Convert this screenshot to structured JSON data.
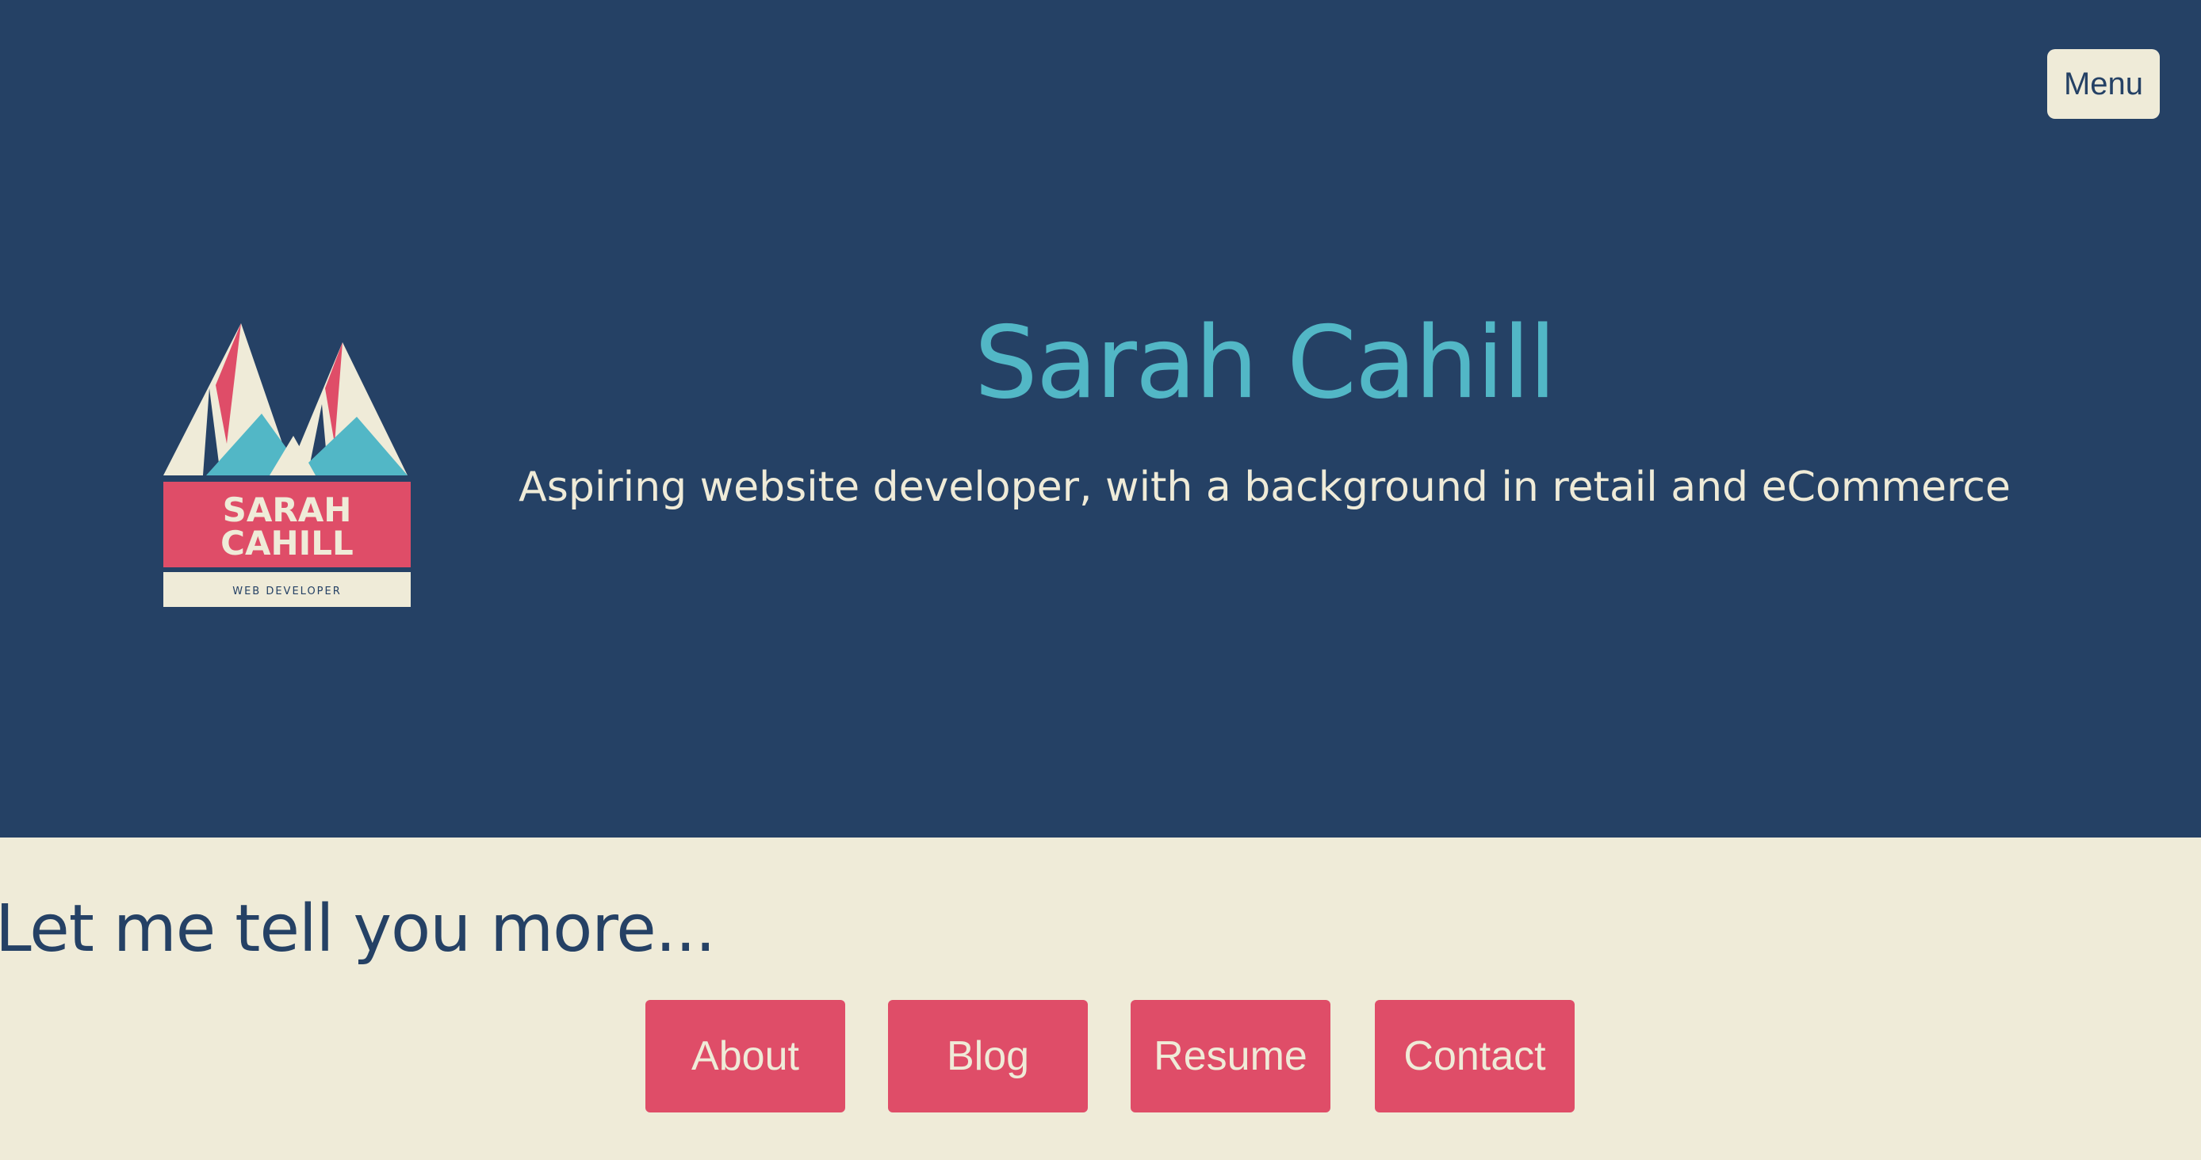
{
  "header": {
    "menu_label": "Menu"
  },
  "hero": {
    "logo": {
      "name_line1": "SARAH",
      "name_line2": "CAHILL",
      "subtitle": "WEB DEVELOPER"
    },
    "title": "Sarah Cahill",
    "tagline": "Aspiring website developer, with a background in retail and eCommerce"
  },
  "more": {
    "heading": "Let me tell you more..."
  },
  "nav": {
    "about": "About",
    "blog": "Blog",
    "resume": "Resume",
    "contact": "Contact"
  },
  "colors": {
    "navy": "#254165",
    "cream": "#efebd8",
    "teal": "#52b7c6",
    "pink": "#df4d68"
  }
}
